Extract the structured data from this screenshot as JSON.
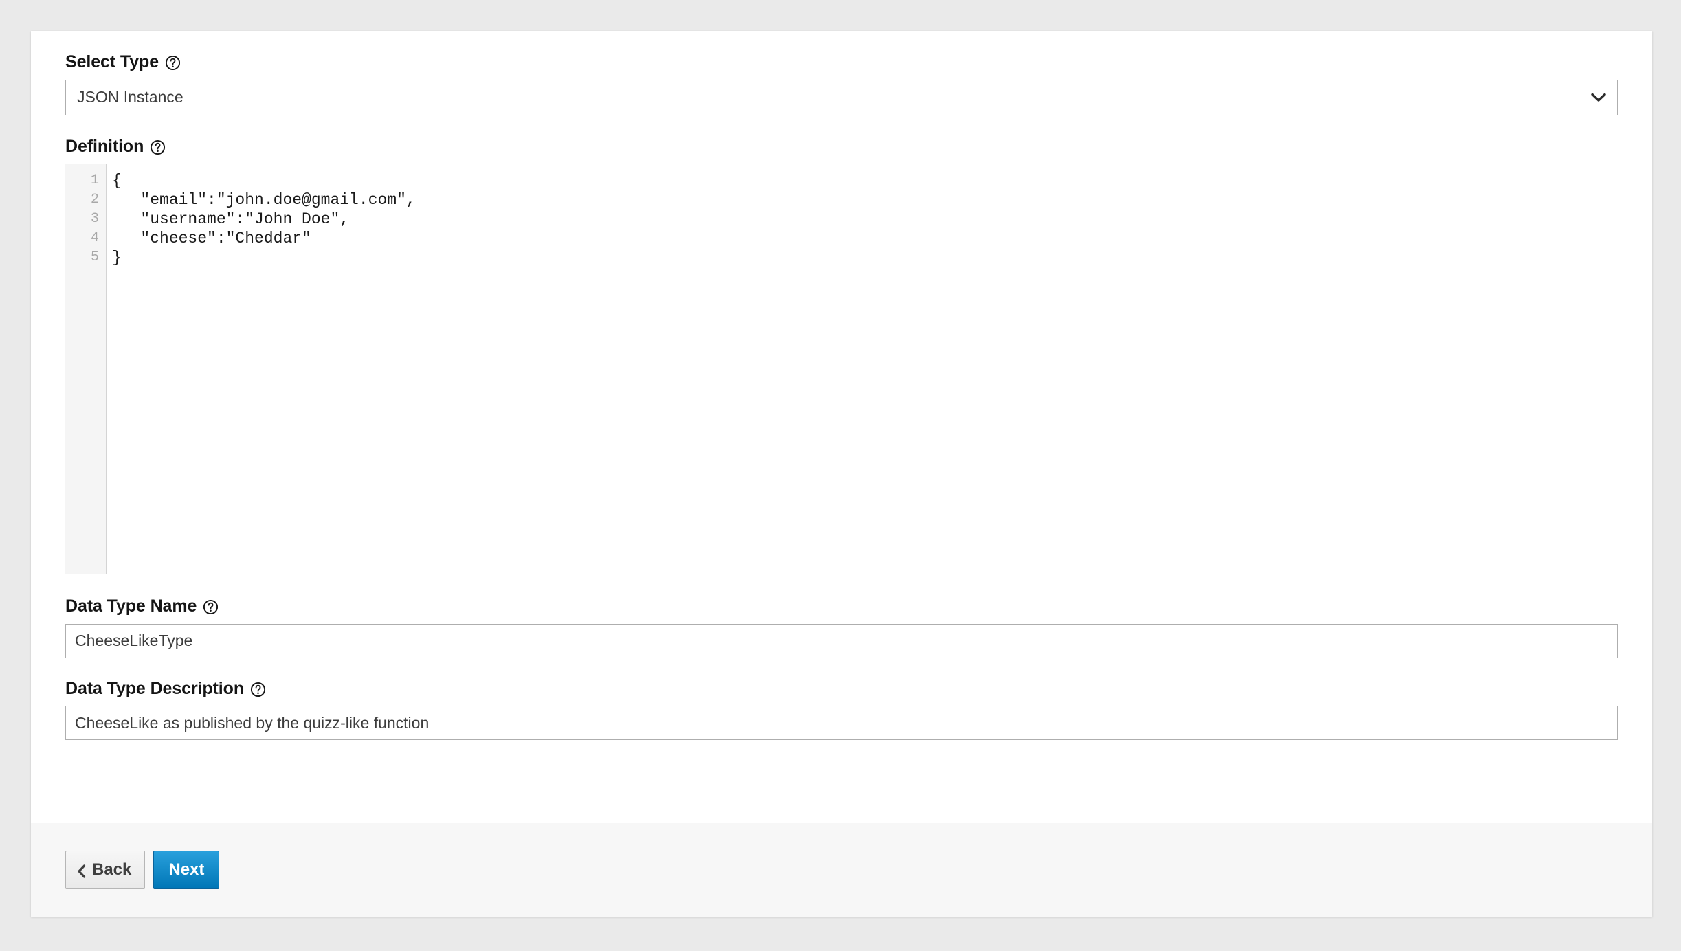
{
  "page": {
    "background_color": "#eaeaea",
    "card_background": "#ffffff"
  },
  "fields": {
    "select_type": {
      "label": "Select Type",
      "help_icon": "help-circle-icon",
      "selected_value": "JSON Instance",
      "chevron_icon": "chevron-down-icon"
    },
    "definition": {
      "label": "Definition",
      "help_icon": "help-circle-icon",
      "line_numbers": [
        "1",
        "2",
        "3",
        "4",
        "5"
      ],
      "code_lines": [
        "{",
        "   \"email\":\"john.doe@gmail.com\",",
        "   \"username\":\"John Doe\",",
        "   \"cheese\":\"Cheddar\"",
        "}"
      ]
    },
    "data_type_name": {
      "label": "Data Type Name",
      "help_icon": "help-circle-icon",
      "value": "CheeseLikeType",
      "placeholder": ""
    },
    "data_type_description": {
      "label": "Data Type Description",
      "help_icon": "help-circle-icon",
      "value": "CheeseLike as published by the quizz-like function",
      "placeholder": ""
    }
  },
  "footer": {
    "back_label": "Back",
    "back_icon": "chevron-left-icon",
    "next_label": "Next",
    "next_color": "#0076b6"
  }
}
